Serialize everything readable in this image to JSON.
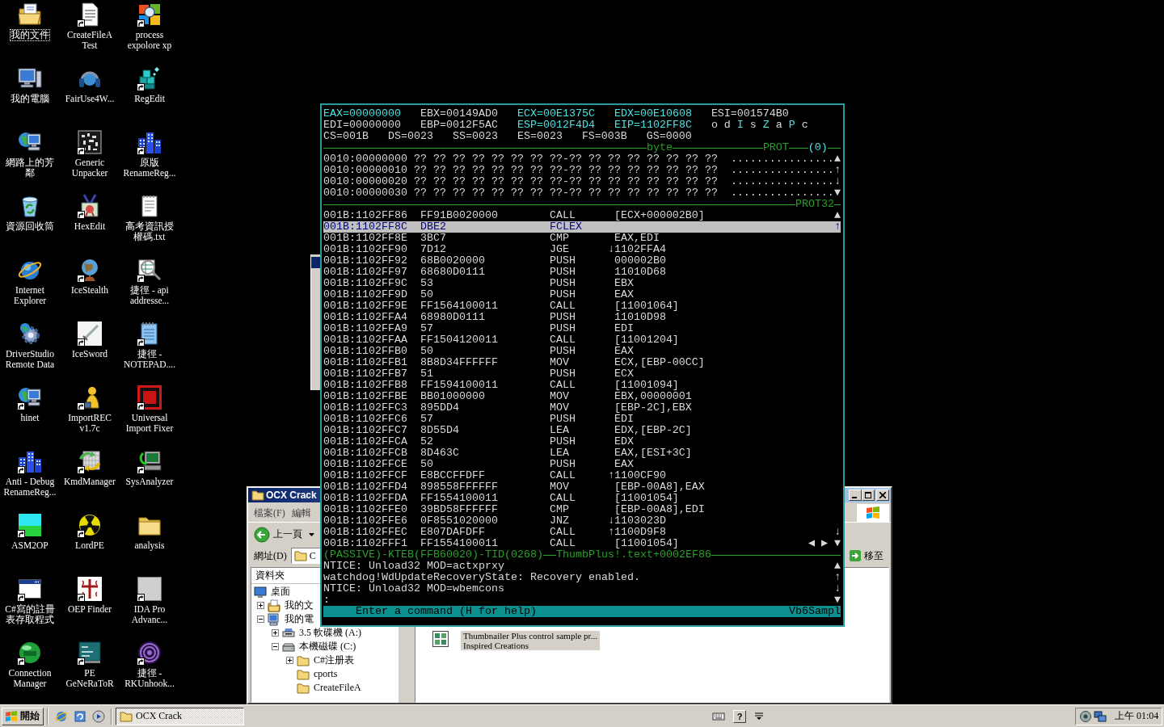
{
  "desktop": {
    "icons": [
      {
        "label": "我的文件",
        "kind": "documents",
        "shortcut": false,
        "selected": true
      },
      {
        "label": "CreateFileA Test",
        "kind": "document",
        "shortcut": true,
        "selected": false
      },
      {
        "label": "process expolore xp",
        "kind": "squares",
        "shortcut": true,
        "selected": false
      },
      {
        "label": "我的電腦",
        "kind": "computer",
        "shortcut": false,
        "selected": false
      },
      {
        "label": "FairUse4W...",
        "kind": "headphones",
        "shortcut": false,
        "selected": false
      },
      {
        "label": "RegEdit",
        "kind": "cubes",
        "shortcut": true,
        "selected": false
      },
      {
        "label": "網路上的芳鄰",
        "kind": "network",
        "shortcut": false,
        "selected": false
      },
      {
        "label": "Generic Unpacker",
        "kind": "pattern",
        "shortcut": true,
        "selected": false
      },
      {
        "label": "原版 RenameReg...",
        "kind": "buildings",
        "shortcut": true,
        "selected": false
      },
      {
        "label": "資源回收筒",
        "kind": "recycle",
        "shortcut": false,
        "selected": false
      },
      {
        "label": "HexEdit",
        "kind": "medal",
        "shortcut": true,
        "selected": false
      },
      {
        "label": "高考資訊授權碼.txt",
        "kind": "textfile",
        "shortcut": false,
        "selected": false
      },
      {
        "label": "Internet Explorer",
        "kind": "browser",
        "shortcut": false,
        "selected": false
      },
      {
        "label": "IceStealth",
        "kind": "globe",
        "shortcut": true,
        "selected": false
      },
      {
        "label": "捷徑 - api addresse...",
        "kind": "magnifier",
        "shortcut": true,
        "selected": false
      },
      {
        "label": "DriverStudio Remote Data",
        "kind": "gear",
        "shortcut": false,
        "selected": false
      },
      {
        "label": "IceSword",
        "kind": "sword",
        "shortcut": true,
        "selected": false
      },
      {
        "label": "捷徑 - NOTEPAD....",
        "kind": "notepad",
        "shortcut": true,
        "selected": false
      },
      {
        "label": "hinet",
        "kind": "network",
        "shortcut": true,
        "selected": false
      },
      {
        "label": "ImportREC v1.7c",
        "kind": "figure",
        "shortcut": true,
        "selected": false
      },
      {
        "label": "Universal Import Fixer",
        "kind": "frame",
        "shortcut": true,
        "selected": false
      },
      {
        "label": "Anti - Debug RenameReg...",
        "kind": "buildings",
        "shortcut": true,
        "selected": false
      },
      {
        "label": "KmdManager",
        "kind": "arrows",
        "shortcut": true,
        "selected": false
      },
      {
        "label": "SysAnalyzer",
        "kind": "terminal",
        "shortcut": true,
        "selected": false
      },
      {
        "label": "ASM2OP",
        "kind": "tile",
        "shortcut": true,
        "selected": false
      },
      {
        "label": "LordPE",
        "kind": "radiation",
        "shortcut": true,
        "selected": false
      },
      {
        "label": "analysis",
        "kind": "folder",
        "shortcut": false,
        "selected": false
      },
      {
        "label": "C#寫的註冊表存取程式",
        "kind": "window",
        "shortcut": true,
        "selected": false
      },
      {
        "label": "OEP Finder",
        "kind": "cross",
        "shortcut": true,
        "selected": false
      },
      {
        "label": "IDA Pro Advanc...",
        "kind": "picture",
        "shortcut": true,
        "selected": false
      },
      {
        "label": "Connection Manager",
        "kind": "disc",
        "shortcut": true,
        "selected": false
      },
      {
        "label": "PE GeNeRaToR",
        "kind": "board",
        "shortcut": true,
        "selected": false
      },
      {
        "label": "捷徑 - RKUnhook...",
        "kind": "spiral",
        "shortcut": true,
        "selected": false
      }
    ]
  },
  "explorer": {
    "title": "OCX Crack",
    "menu": [
      "檔案(F)",
      "編輯"
    ],
    "back_button": "上一頁",
    "address_label": "網址(D)",
    "address_value": "C",
    "go_button": "移至",
    "folder_pane_title": "資料夾",
    "tree": [
      {
        "label": "桌面",
        "kind": "desktop",
        "children": [
          {
            "label": "我的文",
            "kind": "documents",
            "expanded": false
          },
          {
            "label": "我的電",
            "kind": "computer",
            "expanded": true,
            "children": [
              {
                "label": "3.5 軟碟機 (A:)",
                "kind": "floppy",
                "expanded": false
              },
              {
                "label": "本機磁碟 (C:)",
                "kind": "disk",
                "expanded": true,
                "children": [
                  {
                    "label": "C#注册表",
                    "kind": "folder",
                    "expanded": false
                  },
                  {
                    "label": "cports",
                    "kind": "folder"
                  },
                  {
                    "label": "CreateFileA",
                    "kind": "folder"
                  }
                ]
              }
            ]
          }
        ]
      }
    ],
    "files": [
      {
        "description": "Thumbnailer Plus control sample pr...",
        "company": "Inspired Creations",
        "selected": true
      }
    ]
  },
  "debugger": {
    "registers": [
      {
        "text": "EAX=00000000",
        "highlighted": true
      },
      {
        "text": "EBX=00149AD0",
        "highlighted": false
      },
      {
        "text": "ECX=00E1375C",
        "highlighted": true
      },
      {
        "text": "EDX=00E10608",
        "highlighted": true
      },
      {
        "text": "ESI=001574B0",
        "highlighted": false
      },
      {
        "text": "EDI=00000000",
        "highlighted": false
      },
      {
        "text": "EBP=0012F5AC",
        "highlighted": false
      },
      {
        "text": "ESP=0012F4D4",
        "highlighted": true
      },
      {
        "text": "EIP=1102FF8C",
        "highlighted": true
      }
    ],
    "flags": [
      {
        "letter": "o",
        "on": false
      },
      {
        "letter": "d",
        "on": false
      },
      {
        "letter": "I",
        "on": true
      },
      {
        "letter": "s",
        "on": false
      },
      {
        "letter": "Z",
        "on": true
      },
      {
        "letter": "a",
        "on": false
      },
      {
        "letter": "P",
        "on": true
      },
      {
        "letter": "c",
        "on": false
      }
    ],
    "segments": [
      "CS=001B",
      "DS=0023",
      "SS=0023",
      "ES=0023",
      "FS=003B",
      "GS=0000"
    ],
    "memory_header": {
      "format": "byte",
      "mode": "PROT",
      "index": "(0)"
    },
    "memory_rows": [
      {
        "hex": "0010:00000000 ?? ?? ?? ?? ?? ?? ?? ??-?? ?? ?? ?? ?? ?? ?? ??",
        "ascii": "................",
        "marker": "▲"
      },
      {
        "hex": "0010:00000010 ?? ?? ?? ?? ?? ?? ?? ??-?? ?? ?? ?? ?? ?? ?? ??",
        "ascii": "................",
        "marker": "↑"
      },
      {
        "hex": "0010:00000020 ?? ?? ?? ?? ?? ?? ?? ??-?? ?? ?? ?? ?? ?? ?? ??",
        "ascii": "................",
        "marker": "↓"
      },
      {
        "hex": "0010:00000030 ?? ?? ?? ?? ?? ?? ?? ??-?? ?? ?? ?? ?? ?? ?? ??",
        "ascii": "................",
        "marker": "▼"
      }
    ],
    "code_header": "PROT32",
    "code_rows": [
      {
        "address": "001B:1102FF86",
        "bytes": "FF91B0020000",
        "mnemonic": "CALL",
        "operand": "[ECX+000002B0]",
        "selected": false,
        "marker": "▲"
      },
      {
        "address": "001B:1102FF8C",
        "bytes": "DBE2",
        "mnemonic": "FCLEX",
        "selected": true,
        "marker": "↑"
      },
      {
        "address": "001B:1102FF8E",
        "bytes": "3BC7",
        "mnemonic": "CMP",
        "operand": "EAX,EDI",
        "selected": false
      },
      {
        "address": "001B:1102FF90",
        "bytes": "7D12",
        "mnemonic": "JGE",
        "jump": "↓",
        "operand": "1102FFA4",
        "selected": false
      },
      {
        "address": "001B:1102FF92",
        "bytes": "68B0020000",
        "mnemonic": "PUSH",
        "operand": "000002B0",
        "selected": false
      },
      {
        "address": "001B:1102FF97",
        "bytes": "68680D0111",
        "mnemonic": "PUSH",
        "operand": "11010D68",
        "selected": false
      },
      {
        "address": "001B:1102FF9C",
        "bytes": "53",
        "mnemonic": "PUSH",
        "operand": "EBX",
        "selected": false
      },
      {
        "address": "001B:1102FF9D",
        "bytes": "50",
        "mnemonic": "PUSH",
        "operand": "EAX",
        "selected": false
      },
      {
        "address": "001B:1102FF9E",
        "bytes": "FF1564100011",
        "mnemonic": "CALL",
        "operand": "[11001064]",
        "selected": false
      },
      {
        "address": "001B:1102FFA4",
        "bytes": "68980D0111",
        "mnemonic": "PUSH",
        "operand": "11010D98",
        "selected": false
      },
      {
        "address": "001B:1102FFA9",
        "bytes": "57",
        "mnemonic": "PUSH",
        "operand": "EDI",
        "selected": false
      },
      {
        "address": "001B:1102FFAA",
        "bytes": "FF1504120011",
        "mnemonic": "CALL",
        "operand": "[11001204]",
        "selected": false
      },
      {
        "address": "001B:1102FFB0",
        "bytes": "50",
        "mnemonic": "PUSH",
        "operand": "EAX",
        "selected": false
      },
      {
        "address": "001B:1102FFB1",
        "bytes": "8B8D34FFFFFF",
        "mnemonic": "MOV",
        "operand": "ECX,[EBP-00CC]",
        "selected": false
      },
      {
        "address": "001B:1102FFB7",
        "bytes": "51",
        "mnemonic": "PUSH",
        "operand": "ECX",
        "selected": false
      },
      {
        "address": "001B:1102FFB8",
        "bytes": "FF1594100011",
        "mnemonic": "CALL",
        "operand": "[11001094]",
        "selected": false
      },
      {
        "address": "001B:1102FFBE",
        "bytes": "BB01000000",
        "mnemonic": "MOV",
        "operand": "EBX,00000001",
        "selected": false
      },
      {
        "address": "001B:1102FFC3",
        "bytes": "895DD4",
        "mnemonic": "MOV",
        "operand": "[EBP-2C],EBX",
        "selected": false
      },
      {
        "address": "001B:1102FFC6",
        "bytes": "57",
        "mnemonic": "PUSH",
        "operand": "EDI",
        "selected": false
      },
      {
        "address": "001B:1102FFC7",
        "bytes": "8D55D4",
        "mnemonic": "LEA",
        "operand": "EDX,[EBP-2C]",
        "selected": false
      },
      {
        "address": "001B:1102FFCA",
        "bytes": "52",
        "mnemonic": "PUSH",
        "operand": "EDX",
        "selected": false
      },
      {
        "address": "001B:1102FFCB",
        "bytes": "8D463C",
        "mnemonic": "LEA",
        "operand": "EAX,[ESI+3C]",
        "selected": false
      },
      {
        "address": "001B:1102FFCE",
        "bytes": "50",
        "mnemonic": "PUSH",
        "operand": "EAX",
        "selected": false
      },
      {
        "address": "001B:1102FFCF",
        "bytes": "E8BCCFFDFF",
        "mnemonic": "CALL",
        "jump": "↑",
        "operand": "1100CF90",
        "selected": false
      },
      {
        "address": "001B:1102FFD4",
        "bytes": "898558FFFFFF",
        "mnemonic": "MOV",
        "operand": "[EBP-00A8],EAX",
        "selected": false
      },
      {
        "address": "001B:1102FFDA",
        "bytes": "FF1554100011",
        "mnemonic": "CALL",
        "operand": "[11001054]",
        "selected": false
      },
      {
        "address": "001B:1102FFE0",
        "bytes": "39BD58FFFFFF",
        "mnemonic": "CMP",
        "operand": "[EBP-00A8],EDI",
        "selected": false
      },
      {
        "address": "001B:1102FFE6",
        "bytes": "0F8551020000",
        "mnemonic": "JNZ",
        "jump": "↓",
        "operand": "1103023D",
        "selected": false
      },
      {
        "address": "001B:1102FFEC",
        "bytes": "E807DAFDFF",
        "mnemonic": "CALL",
        "jump": "↑",
        "operand": "1100D9F8",
        "selected": false,
        "marker": "↓"
      },
      {
        "address": "001B:1102FFF1",
        "bytes": "FF1554100011",
        "mnemonic": "CALL",
        "operand": "[11001054]",
        "selected": false,
        "marker": "◀ ▶ ▼"
      }
    ],
    "status": {
      "context": "(PASSIVE)-KTEB(FFB60020)-TID(0268)",
      "location": "ThumbPlus!.text+0002EF86"
    },
    "log": [
      {
        "text": "NTICE: Unload32 MOD=actxprxy",
        "marker": "▲"
      },
      {
        "text": "watchdog!WdUpdateRecoveryState: Recovery enabled.",
        "marker": "↑"
      },
      {
        "text": "NTICE: Unload32 MOD=wbemcons",
        "marker": "↓"
      },
      {
        "text": ":",
        "marker": "▼"
      }
    ],
    "help_bar": {
      "hint": "Enter a command (H for help)",
      "module": "Vb6Sampl"
    }
  },
  "taskbar": {
    "start": "開始",
    "tasks": [
      {
        "label": "OCX Crack",
        "selected": true
      }
    ],
    "help_button": "?",
    "clock": "上午 01:04"
  }
}
